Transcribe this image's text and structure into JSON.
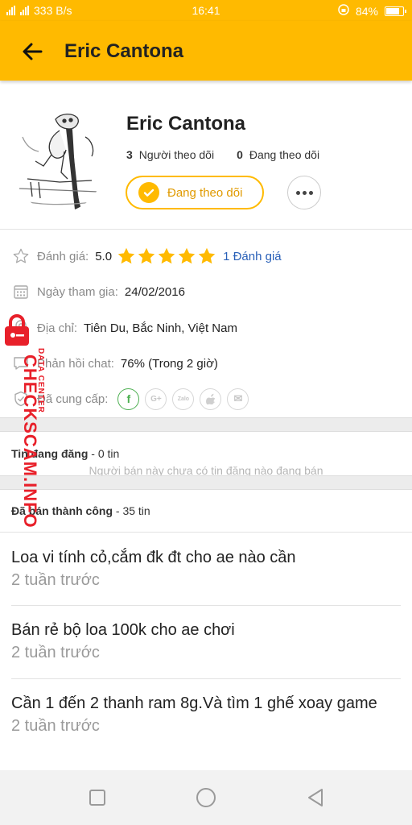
{
  "status_bar": {
    "network_speed": "333 B/s",
    "time": "16:41",
    "battery": "84%",
    "battery_level": 0.84
  },
  "app_bar": {
    "title": "Eric Cantona",
    "back_icon": "arrow-left-icon"
  },
  "profile": {
    "name": "Eric Cantona",
    "followers_count": "3",
    "followers_label": "Người theo dõi",
    "following_count": "0",
    "following_label": "Đang theo dõi",
    "follow_button_label": "Đang theo dõi",
    "avatar_icon": "cartoon-avatar"
  },
  "info": {
    "rating_label": "Đánh giá:",
    "rating_value": "5.0",
    "rating_stars": 5,
    "rating_count": "1 Đánh giá",
    "join_label": "Ngày tham gia:",
    "join_date": "24/02/2016",
    "address_label": "Địa chỉ:",
    "address_value": "Tiên Du, Bắc Ninh, Việt Nam",
    "chat_label": "Phản hồi chat:",
    "chat_value": "76%  (Trong 2 giờ)",
    "provided_label": "Đã cung cấp:",
    "providers": [
      {
        "name": "facebook-icon",
        "glyph": "f",
        "active": true
      },
      {
        "name": "google-plus-icon",
        "glyph": "G+",
        "active": false
      },
      {
        "name": "zalo-icon",
        "glyph": "Zalo",
        "active": false
      },
      {
        "name": "apple-icon",
        "glyph": "",
        "active": false
      },
      {
        "name": "email-icon",
        "glyph": "✉",
        "active": false
      }
    ]
  },
  "sections": {
    "active_title": "Tin đang đăng",
    "active_count": " - 0 tin",
    "active_empty": "Người bán này chưa có tin đăng nào đang bán",
    "sold_title": "Đã bán thành công",
    "sold_count": " - 35 tin"
  },
  "listings": [
    {
      "title": "Loa vi tính cỏ,cắm đk đt cho ae nào cần",
      "date": "2 tuần trước"
    },
    {
      "title": "Bán rẻ bộ loa 100k cho ae chơi",
      "date": "2 tuần trước"
    },
    {
      "title": "Cần 1 đến 2 thanh ram 8g.Và tìm 1 ghế xoay game",
      "date": "2 tuần trước"
    }
  ],
  "watermark": {
    "main": "CHECKSCAM.INFO",
    "sub": "DATA CENTER"
  },
  "colors": {
    "accent": "#FFBA00",
    "star": "#FFBA00",
    "link": "#2960b8",
    "watermark": "#e8202a"
  }
}
